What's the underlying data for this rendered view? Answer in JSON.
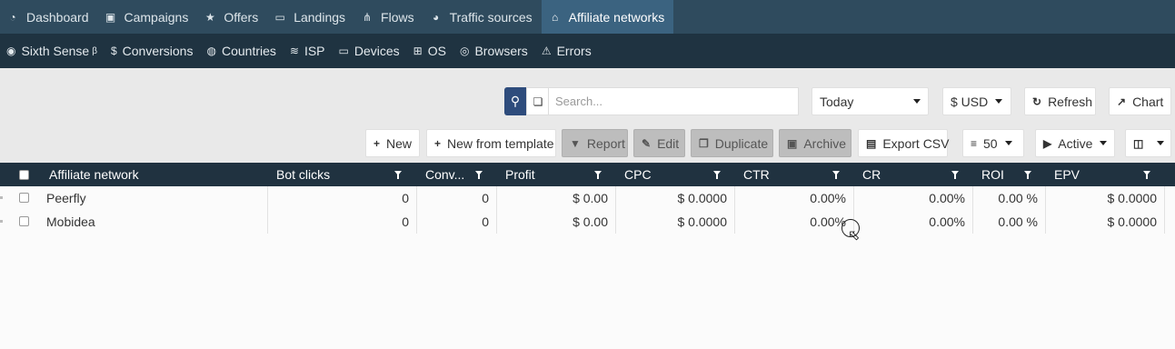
{
  "nav_primary": [
    {
      "label": "Dashboard",
      "icon": "dashboard-icon",
      "glyph": "◔",
      "active": false
    },
    {
      "label": "Campaigns",
      "icon": "briefcase-icon",
      "glyph": "▣",
      "active": false
    },
    {
      "label": "Offers",
      "icon": "star-icon",
      "glyph": "★",
      "active": false
    },
    {
      "label": "Landings",
      "icon": "window-icon",
      "glyph": "▭",
      "active": false
    },
    {
      "label": "Flows",
      "icon": "sitemap-icon",
      "glyph": "⋔",
      "active": false
    },
    {
      "label": "Traffic sources",
      "icon": "globe-icon",
      "glyph": "◕",
      "active": false
    },
    {
      "label": "Affiliate networks",
      "icon": "bank-icon",
      "glyph": "⌂",
      "active": true
    }
  ],
  "nav_secondary": [
    {
      "label": "Sixth Sense",
      "sup": "β",
      "icon": "eye-icon",
      "glyph": "◉"
    },
    {
      "label": "Conversions",
      "sup": "",
      "icon": "dollar-icon",
      "glyph": "$"
    },
    {
      "label": "Countries",
      "sup": "",
      "icon": "globe-icon",
      "glyph": "◍"
    },
    {
      "label": "ISP",
      "sup": "",
      "icon": "wifi-icon",
      "glyph": "≋"
    },
    {
      "label": "Devices",
      "sup": "",
      "icon": "laptop-icon",
      "glyph": "▭"
    },
    {
      "label": "OS",
      "sup": "",
      "icon": "windows-icon",
      "glyph": "⊞"
    },
    {
      "label": "Browsers",
      "sup": "",
      "icon": "browser-icon",
      "glyph": "◎"
    },
    {
      "label": "Errors",
      "sup": "",
      "icon": "warning-icon",
      "glyph": "⚠"
    }
  ],
  "filters": {
    "search_placeholder": "Search...",
    "date_range": "Today",
    "currency": "$ USD",
    "refresh_label": "Refresh",
    "chart_label": "Chart"
  },
  "actions": {
    "new_label": "New",
    "new_from_template_label": "New from template",
    "report_label": "Report",
    "edit_label": "Edit",
    "duplicate_label": "Duplicate",
    "archive_label": "Archive",
    "export_label": "Export CSV",
    "page_size": "50",
    "status_filter": "Active"
  },
  "table": {
    "columns": [
      "Affiliate network",
      "Bot clicks",
      "Conv...",
      "Profit",
      "CPC",
      "CTR",
      "CR",
      "ROI",
      "EPV"
    ],
    "rows": [
      [
        "Peerfly",
        "0",
        "0",
        "$ 0.00",
        "$ 0.0000",
        "0.00%",
        "0.00%",
        "0.00 %",
        "$ 0.0000"
      ],
      [
        "Mobidea",
        "0",
        "0",
        "$ 0.00",
        "$ 0.0000",
        "0.00%",
        "0.00%",
        "0.00 %",
        "$ 0.0000"
      ]
    ]
  },
  "colors": {
    "nav_primary_bg": "#2f4b5e",
    "nav_active_bg": "#3b6380",
    "nav_secondary_bg": "#1f3341",
    "table_header_bg": "#203240",
    "search_button_bg": "#2e4c7c"
  }
}
